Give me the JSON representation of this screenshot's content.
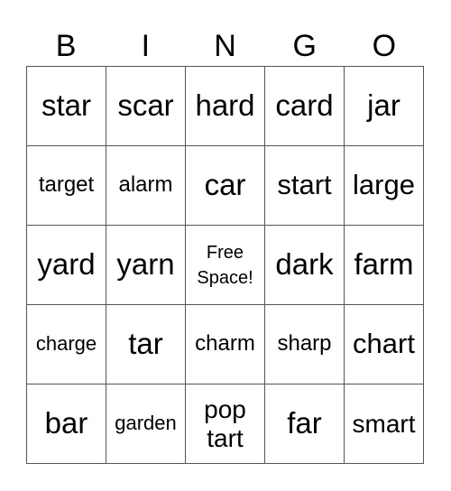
{
  "header": [
    "B",
    "I",
    "N",
    "G",
    "O"
  ],
  "card": {
    "rows": [
      [
        "star",
        "scar",
        "hard",
        "card",
        "jar"
      ],
      [
        "target",
        "alarm",
        "car",
        "start",
        "large"
      ],
      [
        "yard",
        "yarn",
        "Free\nSpace!",
        "dark",
        "farm"
      ],
      [
        "charge",
        "tar",
        "charm",
        "sharp",
        "chart"
      ],
      [
        "bar",
        "garden",
        "pop\ntart",
        "far",
        "smart"
      ]
    ],
    "free_space_position": [
      2,
      2
    ]
  }
}
